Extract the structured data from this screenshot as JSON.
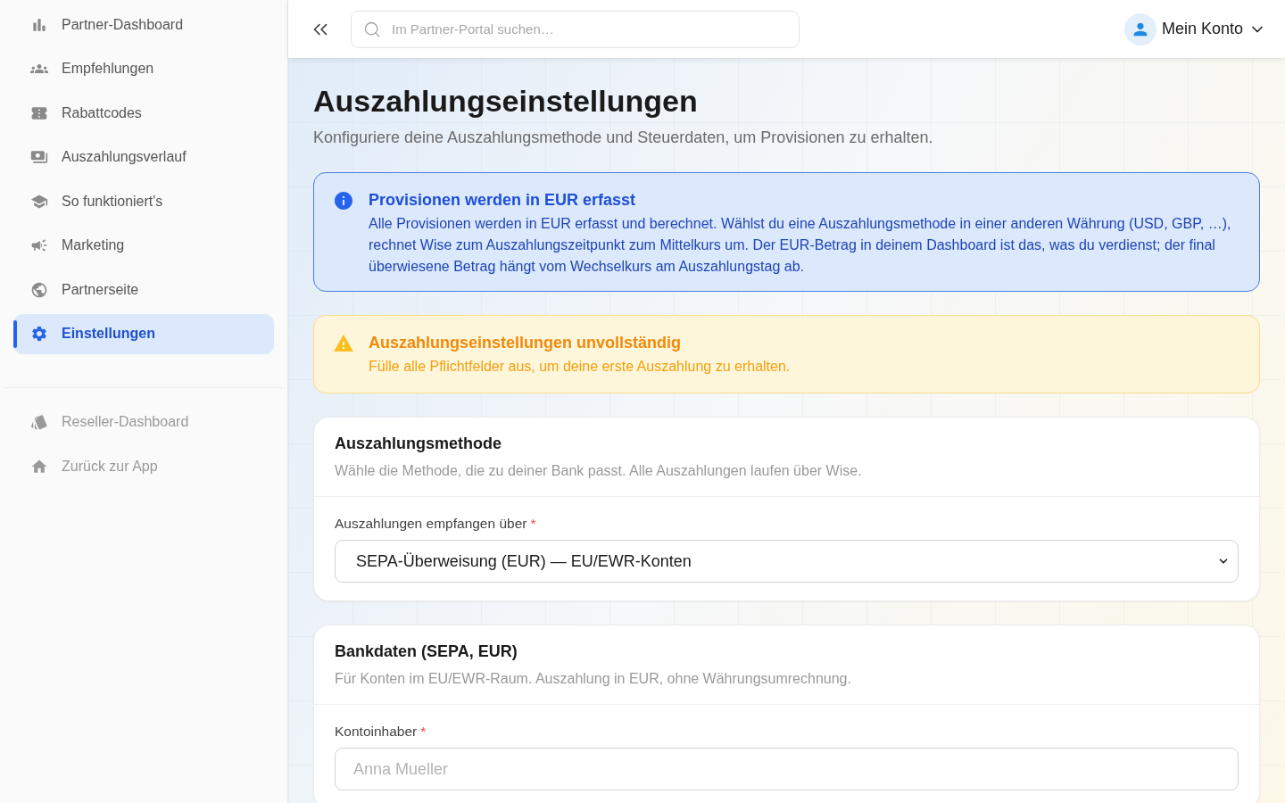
{
  "sidebar": {
    "items": [
      {
        "label": "Partner-Dashboard",
        "selected": false
      },
      {
        "label": "Empfehlungen",
        "selected": false
      },
      {
        "label": "Rabattcodes",
        "selected": false
      },
      {
        "label": "Auszahlungsverlauf",
        "selected": false
      },
      {
        "label": "So funktioniert's",
        "selected": false
      },
      {
        "label": "Marketing",
        "selected": false
      },
      {
        "label": "Partnerseite",
        "selected": false
      },
      {
        "label": "Einstellungen",
        "selected": true
      }
    ],
    "footer_items": [
      {
        "label": "Reseller-Dashboard"
      },
      {
        "label": "Zurück zur App"
      }
    ]
  },
  "header": {
    "search": {
      "placeholder": "Im Partner-Portal suchen…"
    },
    "account": {
      "label": "Mein Konto"
    }
  },
  "page": {
    "title": "Auszahlungseinstellungen",
    "subtitle": "Konfiguriere deine Auszahlungsmethode und Steuerdaten, um Provisionen zu erhalten."
  },
  "alerts": [
    {
      "kind": "info",
      "title": "Provisionen werden in EUR erfasst",
      "text": "Alle Provisionen werden in EUR erfasst und berechnet. Wählst du eine Auszahlungsmethode in einer anderen Währung (USD, GBP, …), rechnet Wise zum Auszahlungszeitpunkt zum Mittelkurs um. Der EUR-Betrag in deinem Dashboard ist das, was du verdienst; der final überwiesene Betrag hängt vom Wechselkurs am Auszahlungstag ab."
    },
    {
      "kind": "warning",
      "title": "Auszahlungseinstellungen unvollständig",
      "text": "Fülle alle Pflichtfelder aus, um deine erste Auszahlung zu erhalten."
    }
  ],
  "sections": [
    {
      "title": "Auszahlungsmethode",
      "description": "Wähle die Methode, die zu deiner Bank passt. Alle Auszahlungen laufen über Wise.",
      "fields": [
        {
          "kind": "select",
          "label": "Auszahlungen empfangen über",
          "required_mark": "*",
          "value": "SEPA-Überweisung (EUR) — EU/EWR-Konten"
        }
      ]
    },
    {
      "title": "Bankdaten (SEPA, EUR)",
      "description": "Für Konten im EU/EWR-Raum. Auszahlung in EUR, ohne Währungsumrechnung.",
      "fields": [
        {
          "kind": "text",
          "label": "Kontoinhaber",
          "required_mark": "*",
          "placeholder": "Anna Mueller"
        }
      ]
    }
  ]
}
